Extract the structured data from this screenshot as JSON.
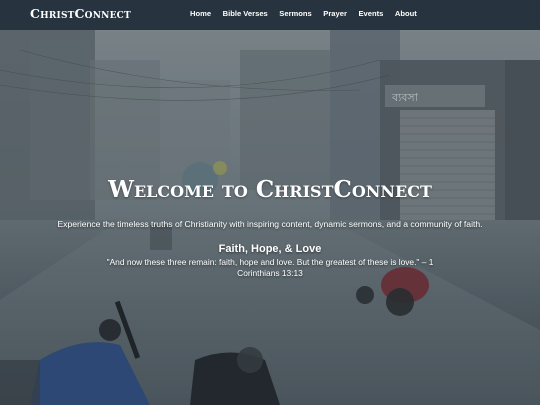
{
  "navbar": {
    "brand": "ChristConnect",
    "links": [
      "Home",
      "Bible Verses",
      "Sermons",
      "Prayer",
      "Events",
      "About"
    ]
  },
  "hero": {
    "title": "Welcome to ChristConnect",
    "tagline": "Experience the timeless truths of Christianity with inspiring content, dynamic sermons, and a community of faith.",
    "verse_heading": "Faith, Hope, & Love",
    "verse_text": "\"And now these three remain: faith, hope and love. But the greatest of these is love.\" – 1 Corinthians 13:13",
    "shop_sign": "ব্যবসা"
  },
  "colors": {
    "navbar_bg": "#27343f",
    "text": "#ffffff"
  }
}
